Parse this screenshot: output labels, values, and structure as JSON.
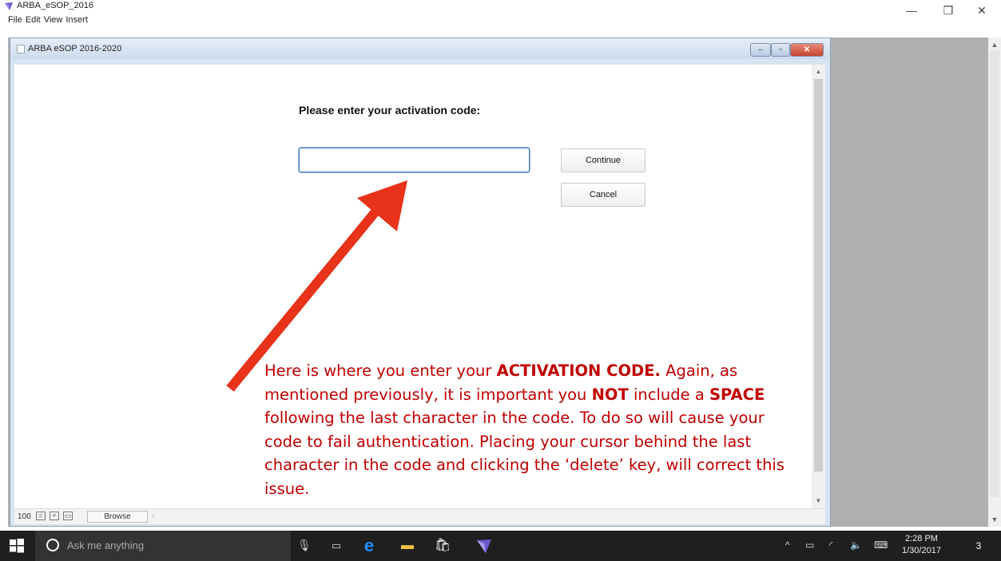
{
  "app": {
    "title": "ARBA_eSOP_2016",
    "menu": [
      "File",
      "Edit",
      "View",
      "Insert"
    ],
    "controls": {
      "minimize": "—",
      "restore": "❐",
      "close": "✕"
    }
  },
  "inner_window": {
    "title": "ARBA eSOP 2016-2020",
    "controls": {
      "minimize": "–",
      "maximize": "▫",
      "close": "✕"
    }
  },
  "dialog": {
    "prompt": "Please enter your activation code:",
    "input_value": "",
    "continue_label": "Continue",
    "cancel_label": "Cancel"
  },
  "statusbar": {
    "zoom": "100",
    "mode": "Browse"
  },
  "annotation": {
    "color": "#c00000",
    "p1": "Here is where you enter your ",
    "b1": "ACTIVATION CODE.",
    "p2": " Again, as mentioned previously, it is important you ",
    "b2": "NOT",
    "p3": " include a ",
    "b3": "SPACE",
    "p4": " following the last character in the code. To do so will cause your code to fail authentication. Placing your cursor behind the last character in the code and clicking the ‘delete’ key, will correct this issue."
  },
  "taskbar": {
    "search_placeholder": "Ask me anything",
    "time": "2:28 PM",
    "date": "1/30/2017",
    "notification_count": "3"
  }
}
